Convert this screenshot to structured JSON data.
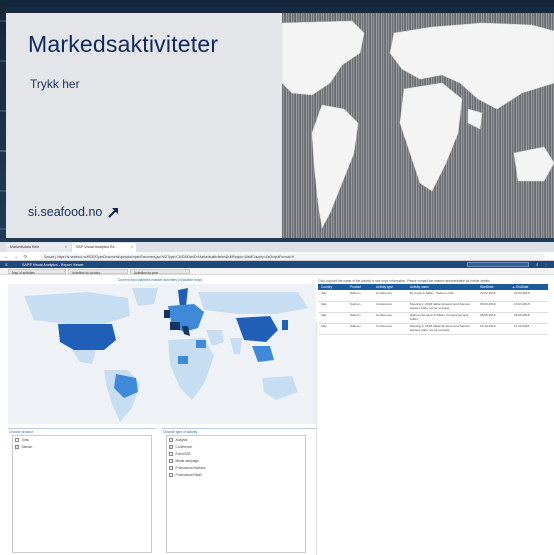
{
  "card": {
    "title": "Markedsaktiviteter",
    "cta": "Trykk her",
    "url": "si.seafood.no",
    "link_icon": "north-east-arrow-icon",
    "colors": {
      "background": "#e4e5e9",
      "text": "#0e2a5c",
      "topbar": "#142b44"
    }
  },
  "browser": {
    "tabs": [
      {
        "label": "Markedsdata Hele",
        "active": false
      },
      {
        "label": "SAP Visual Analytics Re...",
        "active": true
      }
    ],
    "url": "Secure | https://si.seafood.no/BOE/OpenDocument/opendoc/openDocument.jsp?sIDType=CUID&iDocID=Markedsaktiviteter&lsMRegion=&lsMCountry=&sOutputFormat=H",
    "nav_buttons": "← → ⟳"
  },
  "app": {
    "title": "SAP® Visual Analytics - Report Viewer",
    "menu_icon": "hamburger-icon",
    "search_icon": "search-icon",
    "subtabs": [
      "Map of activities",
      "Activities by country",
      "Activities by year"
    ],
    "accent": "#1c4a7e"
  },
  "map": {
    "title": "Current and planned market activities (clickable map)"
  },
  "filters": [
    {
      "title": "Choose product",
      "items": [
        {
          "label": "Torsk",
          "checked": false
        },
        {
          "label": "Salmon",
          "checked": true
        }
      ]
    },
    {
      "title": "Choose type of activity",
      "items": [
        {
          "label": "Analysis",
          "checked": false
        },
        {
          "label": "Conference",
          "checked": true
        },
        {
          "label": "Event B2B",
          "checked": false
        },
        {
          "label": "Media campaign",
          "checked": false
        },
        {
          "label": "Promotional mkt/fairs",
          "checked": false
        },
        {
          "label": "Promotional Retail",
          "checked": false
        }
      ]
    }
  ],
  "table": {
    "note": "Click on/point the name of the activity to see more information. Please contact the market representative for further details.",
    "columns": [
      "Country",
      "Product",
      "Activity type",
      "Activity name",
      "StartDate",
      "▲ EndDate"
    ],
    "rows": [
      [
        "Italy",
        "Salmon",
        "Conference",
        "By Invite in Milan - Salmon crab",
        "22.02.2018",
        "22.03.2018"
      ],
      [
        "Italy",
        "Salmon",
        "Conference",
        "Meeting 1: 2018 Italian Experts and Salmon leaders (date not be revised)",
        "06.03.2018",
        "10.03.2018"
      ],
      [
        "Italy",
        "Salmon",
        "Conference",
        "Salmon Seminar in Milan. Conference and buffet",
        "06.06.2018",
        "06.06.2018"
      ],
      [
        "Italy",
        "Salmon",
        "Conference",
        "Meeting 2: 2018 Italian Experts and Salmon leaders (date not be revised)",
        "10.10.2018",
        "11.10.2018"
      ]
    ]
  }
}
